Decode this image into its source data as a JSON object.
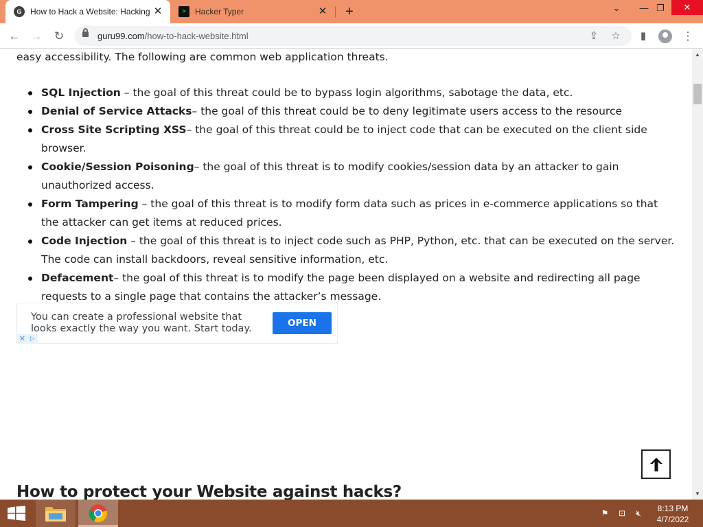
{
  "browser": {
    "tabs": [
      {
        "title": "How to Hack a Website: Hacking",
        "favicon": "G",
        "active": true
      },
      {
        "title": "Hacker Typer",
        "favicon": ">",
        "active": false
      }
    ],
    "url_domain": "guru99.com",
    "url_path": "/how-to-hack-website.html",
    "accent": "#f0936a"
  },
  "page": {
    "intro": "easy accessibility. The following are common web application threats.",
    "threats": [
      {
        "term": "SQL Injection",
        "desc": " – the goal of this threat could be to bypass login algorithms, sabotage the data, etc."
      },
      {
        "term": "Denial of Service Attacks",
        "desc": "– the goal of this threat could be to deny legitimate users access to the resource"
      },
      {
        "term": "Cross Site Scripting XSS",
        "desc": "– the goal of this threat could be to inject code that can be executed on the client side browser."
      },
      {
        "term": "Cookie/Session Poisoning",
        "desc": "– the goal of this threat is to modify cookies/session data by an attacker to gain unauthorized access."
      },
      {
        "term": "Form Tampering",
        "desc": " – the goal of this threat is to modify form data such as prices in e-commerce applications so that the attacker can get items at reduced prices."
      },
      {
        "term": "Code Injection",
        "desc": " – the goal of this threat is to inject code such as PHP, Python, etc. that can be executed on the server. The code can install backdoors, reveal sensitive information, etc."
      },
      {
        "term": "Defacement",
        "desc": "– the goal of this threat is to modify the page been displayed on a website and redirecting all page requests to a single page that contains the attacker’s message."
      }
    ],
    "ad": {
      "text": "You can create a professional website that looks exactly the way you want. Start today.",
      "button": "OPEN"
    },
    "section_heading": "How to protect your Website against hacks?"
  },
  "taskbar": {
    "time": "8:13 PM",
    "date": "4/7/2022"
  }
}
